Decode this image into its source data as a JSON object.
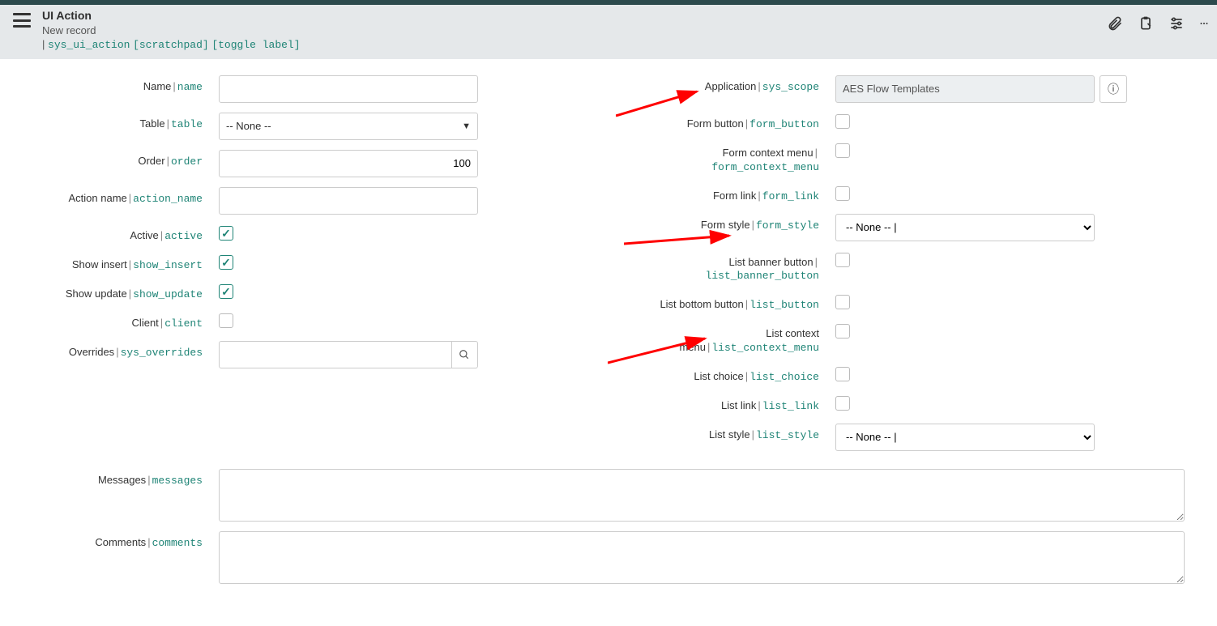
{
  "header": {
    "title": "UI Action",
    "subtitle": "New record",
    "sys_class": "sys_ui_action",
    "link_scratchpad": "[scratchpad]",
    "link_toggle": "[toggle label]"
  },
  "left": {
    "name": {
      "label": "Name",
      "tech": "name",
      "value": ""
    },
    "table": {
      "label": "Table",
      "tech": "table",
      "value": "-- None --"
    },
    "order": {
      "label": "Order",
      "tech": "order",
      "value": "100"
    },
    "action_name": {
      "label": "Action name",
      "tech": "action_name",
      "value": ""
    },
    "active": {
      "label": "Active",
      "tech": "active",
      "checked": true
    },
    "show_insert": {
      "label": "Show insert",
      "tech": "show_insert",
      "checked": true
    },
    "show_update": {
      "label": "Show update",
      "tech": "show_update",
      "checked": true
    },
    "client": {
      "label": "Client",
      "tech": "client",
      "checked": false
    },
    "overrides": {
      "label": "Overrides",
      "tech": "sys_overrides",
      "value": ""
    }
  },
  "right": {
    "application": {
      "label": "Application",
      "tech": "sys_scope",
      "value": "AES Flow Templates"
    },
    "form_button": {
      "label": "Form button",
      "tech": "form_button",
      "checked": false
    },
    "form_context_menu": {
      "label": "Form context menu",
      "tech": "form_context_menu",
      "checked": false
    },
    "form_link": {
      "label": "Form link",
      "tech": "form_link",
      "checked": false
    },
    "form_style": {
      "label": "Form style",
      "tech": "form_style",
      "value": "-- None -- |"
    },
    "list_banner_button": {
      "label": "List banner button",
      "tech": "list_banner_button",
      "checked": false
    },
    "list_button": {
      "label": "List bottom button",
      "tech": "list_button",
      "checked": false
    },
    "list_context_menu": {
      "label": "List context menu",
      "tech": "list_context_menu",
      "checked": false
    },
    "list_choice": {
      "label": "List choice",
      "tech": "list_choice",
      "checked": false
    },
    "list_link": {
      "label": "List link",
      "tech": "list_link",
      "checked": false
    },
    "list_style": {
      "label": "List style",
      "tech": "list_style",
      "value": "-- None -- |"
    }
  },
  "bottom": {
    "messages": {
      "label": "Messages",
      "tech": "messages",
      "value": ""
    },
    "comments": {
      "label": "Comments",
      "tech": "comments",
      "value": ""
    }
  }
}
